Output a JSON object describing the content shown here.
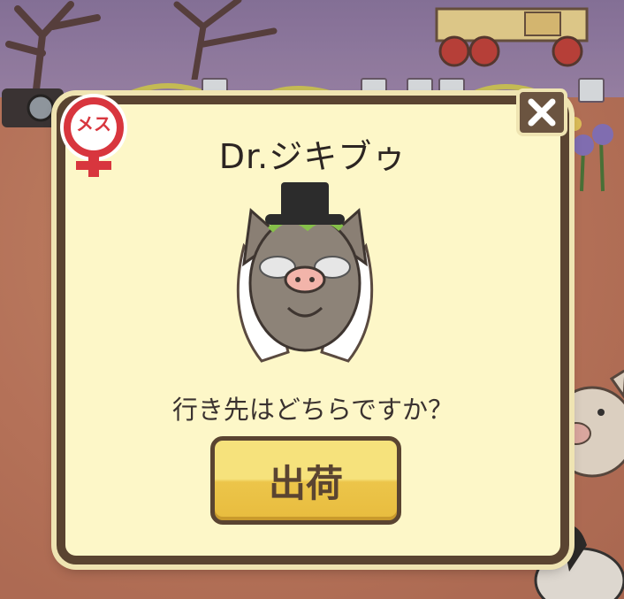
{
  "dialog": {
    "pig_name": "Dr.ジキブゥ",
    "question": "行き先はどちらですか？",
    "ship_button_label": "出荷",
    "gender_badge_label": "メス"
  },
  "colors": {
    "dialog_bg": "#fdf7c8",
    "dialog_border": "#5a4431",
    "button_yellow": "#f6e27c",
    "badge_red": "#d8363e"
  },
  "icons": {
    "close": "close-icon",
    "gender": "female-symbol-icon"
  }
}
